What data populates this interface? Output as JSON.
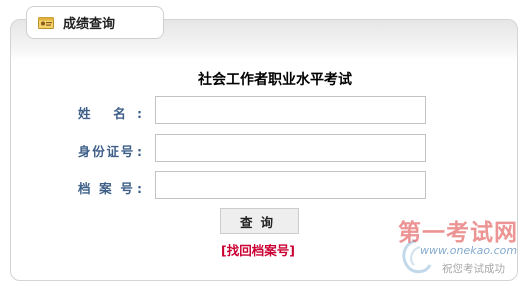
{
  "tab": {
    "title": "成绩查询",
    "icon": "id-card-icon"
  },
  "form": {
    "title": "社会工作者职业水平考试",
    "name_label": "姓 名",
    "id_label": "身份证号",
    "file_label": "档 案 号",
    "colon": ":",
    "name_value": "",
    "id_value": "",
    "file_value": ""
  },
  "actions": {
    "query_label": "查询",
    "find_link": "[找回档案号]"
  },
  "watermark": {
    "title": "第一考试网",
    "url": "www.onekao.com",
    "slogan": "祝您考试成功"
  },
  "colors": {
    "label": "#3d5f88",
    "link": "#cc0033",
    "border": "#c3c3c3"
  }
}
